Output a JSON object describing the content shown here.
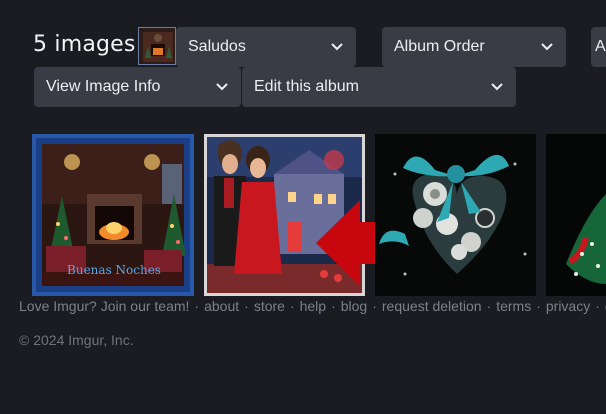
{
  "album": {
    "count_label": "5 images",
    "title_select": "Saludos",
    "order_select": "Album Order",
    "info_select": "View Image Info",
    "edit_select": "Edit this album",
    "cut_select": "A"
  },
  "thumbs": [
    {
      "alt": "fireplace-christmas",
      "caption": "Buenas Noches"
    },
    {
      "alt": "couple-castle"
    },
    {
      "alt": "teal-bow-heart"
    },
    {
      "alt": "green-gift-partial"
    }
  ],
  "footer": {
    "links": [
      "Love Imgur? Join our team!",
      "about",
      "store",
      "help",
      "blog",
      "request deletion",
      "terms",
      "privacy",
      "c"
    ],
    "copyright": "© 2024 Imgur, Inc."
  },
  "colors": {
    "background": "#1b1c21",
    "select_bg": "#3a3c45",
    "arrow": "#c8060e",
    "footer_text": "#7d8089"
  }
}
